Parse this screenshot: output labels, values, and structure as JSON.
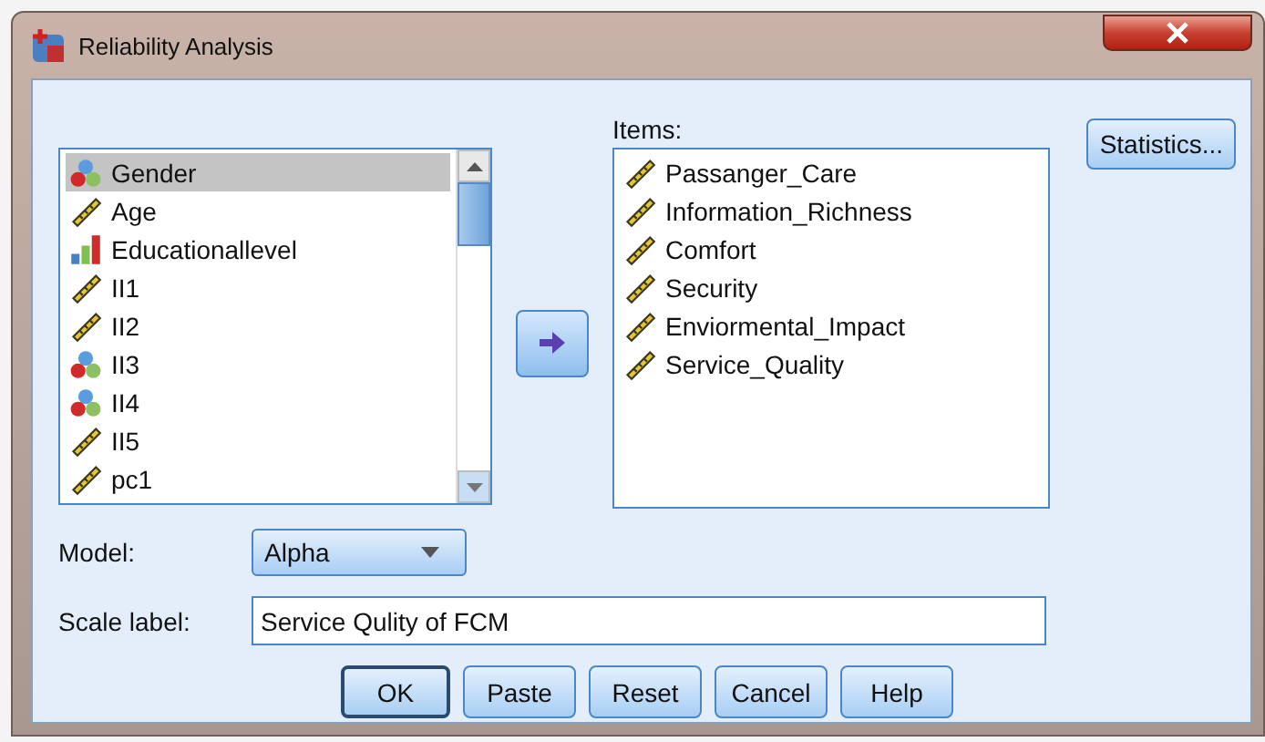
{
  "window": {
    "title": "Reliability Analysis"
  },
  "variables": [
    {
      "name": "Gender",
      "kind": "nominal",
      "selected": true
    },
    {
      "name": "Age",
      "kind": "scale",
      "selected": false
    },
    {
      "name": "Educationallevel",
      "kind": "ordinal",
      "selected": false
    },
    {
      "name": "II1",
      "kind": "scale",
      "selected": false
    },
    {
      "name": "II2",
      "kind": "scale",
      "selected": false
    },
    {
      "name": "II3",
      "kind": "nominal",
      "selected": false
    },
    {
      "name": "II4",
      "kind": "nominal",
      "selected": false
    },
    {
      "name": "II5",
      "kind": "scale",
      "selected": false
    },
    {
      "name": "pc1",
      "kind": "scale",
      "selected": false
    }
  ],
  "items": {
    "label": "Items:",
    "list": [
      {
        "name": "Passanger_Care",
        "kind": "scale"
      },
      {
        "name": "Information_Richness",
        "kind": "scale"
      },
      {
        "name": "Comfort",
        "kind": "scale"
      },
      {
        "name": "Security",
        "kind": "scale"
      },
      {
        "name": "Enviormental_Impact",
        "kind": "scale"
      },
      {
        "name": "Service_Quality",
        "kind": "scale"
      }
    ]
  },
  "statistics_button": "Statistics...",
  "model": {
    "label": "Model:",
    "value": "Alpha"
  },
  "scale_label": {
    "label": "Scale label:",
    "value": "Service Qulity of FCM"
  },
  "buttons": [
    {
      "label": "OK",
      "default": true
    },
    {
      "label": "Paste",
      "default": false
    },
    {
      "label": "Reset",
      "default": false
    },
    {
      "label": "Cancel",
      "default": false
    },
    {
      "label": "Help",
      "default": false
    }
  ]
}
